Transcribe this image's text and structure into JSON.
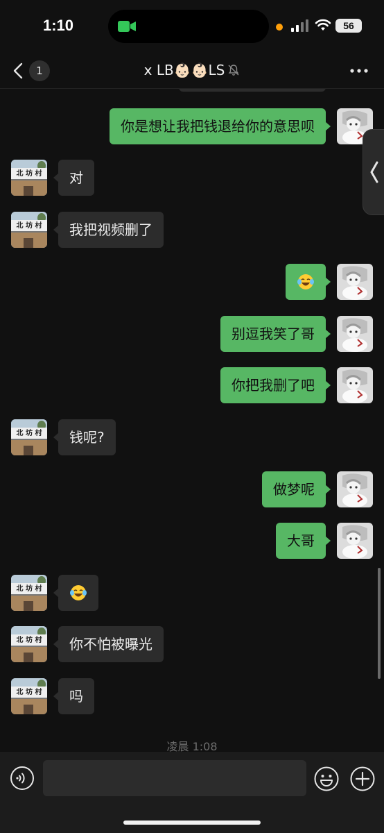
{
  "status_bar": {
    "time": "1:10",
    "battery": "56",
    "icons": [
      "facetime-video-icon",
      "recording-dot-icon",
      "signal-icon",
      "wifi-icon",
      "battery-icon"
    ]
  },
  "nav": {
    "unread_count": "1",
    "title": "x LB👶🏻👶🏻LS",
    "icons": [
      "back-chevron-icon",
      "mute-bell-icon",
      "more-dots-icon"
    ]
  },
  "messages": [
    {
      "side": "right",
      "text": "你是想让我把钱退给你的意思呗"
    },
    {
      "side": "left",
      "text": "对"
    },
    {
      "side": "left",
      "text": "我把视频删了"
    },
    {
      "side": "right",
      "text": "",
      "emoji": "face-with-tears-of-joy"
    },
    {
      "side": "right",
      "text": "别逗我笑了哥"
    },
    {
      "side": "right",
      "text": "你把我删了吧"
    },
    {
      "side": "left",
      "text": "钱呢?"
    },
    {
      "side": "right",
      "text": "做梦呢"
    },
    {
      "side": "right",
      "text": "大哥"
    },
    {
      "side": "left",
      "text": "",
      "emoji": "face-with-tears-of-joy"
    },
    {
      "side": "left",
      "text": "你不怕被曝光"
    },
    {
      "side": "left",
      "text": "吗"
    }
  ],
  "avatars": {
    "left_avatar_sign": "北 坊 村"
  },
  "timestamp": "凌晨 1:08",
  "input": {
    "placeholder": "",
    "value": ""
  },
  "colors": {
    "background": "#111111",
    "sent_bubble": "#57b764",
    "received_bubble": "#2c2c2c",
    "input_bar": "#1c1c1c"
  }
}
